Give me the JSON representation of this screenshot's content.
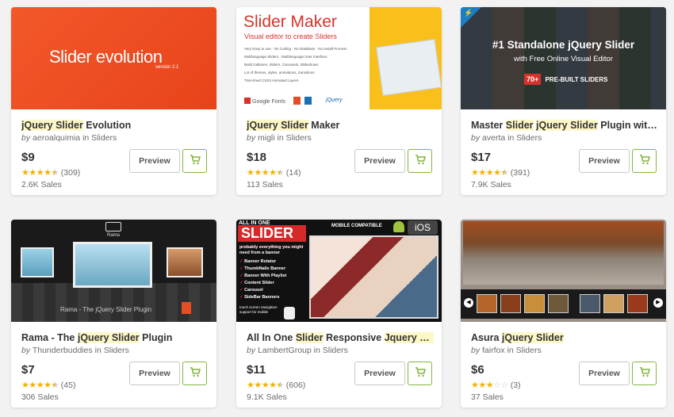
{
  "colors": {
    "accent": "#82b541",
    "star": "#f5b100",
    "highlight": "#fdf7c8",
    "background": "#f2f2f2"
  },
  "icons": {
    "cart": "shopping-cart-icon",
    "star": "star-icon"
  },
  "cards": [
    {
      "title_parts": [
        "jQuery Slider",
        " Evolution"
      ],
      "by_prefix": "by",
      "author": "aeroalquimia",
      "in_text": "in Sliders",
      "price": "$9",
      "rating_value": 4.5,
      "reviews": "(309)",
      "sales": "2.6K Sales",
      "preview_label": "Preview",
      "thumb": {
        "brand": "Slider evolution",
        "version": "version 2.1",
        "bg": "#ef4a1c"
      }
    },
    {
      "title_parts": [
        "jQuery Slider",
        " Maker"
      ],
      "by_prefix": "by",
      "author": "migli",
      "in_text": "in Sliders",
      "price": "$18",
      "rating_value": 4.5,
      "reviews": "(14)",
      "sales": "113 Sales",
      "preview_label": "Preview",
      "thumb": {
        "brand": "Slider Maker",
        "subtitle": "Visual editor to create Sliders",
        "features": [
          "Very Easy to use · No Coding · No Database · No Install Process",
          "Multilanguage Sliders · Multilanguage User Interface",
          "Build Galleries, Sliders, Carousels, Slideshows",
          "Lot of themes, styles, animations, transitions",
          "Time-lined CSS3 Animated Layers"
        ],
        "footer_google": "Google Fonts",
        "footer_jquery": "jQuery"
      }
    },
    {
      "title_parts": [
        "Master ",
        "Slider",
        " ",
        "jQuery Slider",
        " Plugin with Vi..."
      ],
      "by_prefix": "by",
      "author": "averta",
      "in_text": "in Sliders",
      "price": "$17",
      "rating_value": 4.5,
      "reviews": "(391)",
      "sales": "7.9K Sales",
      "preview_label": "Preview",
      "thumb": {
        "headline": "#1 Standalone jQuery Slider",
        "subline": "with Free Online Visual Editor",
        "badge_num": "70+",
        "badge_text": "PRE-BUILT SLIDERS"
      }
    },
    {
      "title_parts": [
        "Rama - The ",
        "jQuery Slider",
        " Plugin"
      ],
      "by_prefix": "by",
      "author": "Thunderbuddies",
      "in_text": "in Sliders",
      "price": "$7",
      "rating_value": 4.5,
      "reviews": "(45)",
      "sales": "306 Sales",
      "preview_label": "Preview",
      "thumb": {
        "logo": "Rama",
        "caption": "Rama - The jQuery Slider Plugin"
      }
    },
    {
      "title_parts": [
        "All In One ",
        "Slider",
        " Responsive ",
        "Jquery Slide..."
      ],
      "by_prefix": "by",
      "author": "LambertGroup",
      "in_text": "in Sliders",
      "price": "$11",
      "rating_value": 4.5,
      "reviews": "(606)",
      "sales": "9.1K Sales",
      "preview_label": "Preview",
      "thumb": {
        "top": "ALL IN ONE",
        "big": "SLIDER",
        "mobile": "MOBILE COMPATIBLE",
        "ios": "iOS",
        "intro": "probably everything you might need from a banner",
        "features": [
          "Banner Rotator",
          "ThumbNails Banner",
          "Banner With Playlist",
          "Content Slider",
          "Carousel",
          "SideBar Banners"
        ],
        "touch": "touch screen navigation support for mobile"
      }
    },
    {
      "title_parts": [
        "Asura ",
        "jQuery Slider"
      ],
      "by_prefix": "by",
      "author": "fairfox",
      "in_text": "in Sliders",
      "price": "$6",
      "rating_value": 3,
      "reviews": "(3)",
      "sales": "37 Sales",
      "preview_label": "Preview",
      "thumb": {}
    }
  ]
}
